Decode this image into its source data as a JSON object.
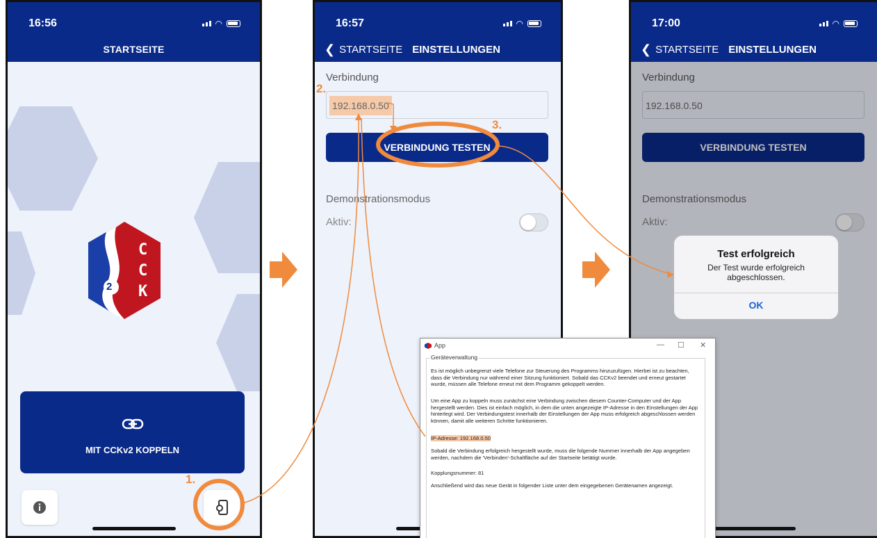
{
  "phone1": {
    "time": "16:56",
    "title": "STARTSEITE",
    "logo_letters": [
      "C",
      "C",
      "K"
    ],
    "logo_number": "2",
    "couple_button_label": "MIT CCKv2 KOPPELN"
  },
  "phone2": {
    "time": "16:57",
    "nav_back": "STARTSEITE",
    "nav_title": "EINSTELLUNGEN",
    "connection_label": "Verbindung",
    "ip_value": "192.168.0.50",
    "test_button_label": "VERBINDUNG TESTEN",
    "demo_label": "Demonstrationsmodus",
    "active_label": "Aktiv:"
  },
  "phone3": {
    "time": "17:00",
    "nav_back": "STARTSEITE",
    "nav_title": "EINSTELLUNGEN",
    "connection_label": "Verbindung",
    "ip_value": "192.168.0.50",
    "test_button_label": "VERBINDUNG TESTEN",
    "demo_label": "Demonstrationsmodus",
    "active_label": "Aktiv:",
    "alert": {
      "title": "Test erfolgreich",
      "message": "Der Test wurde erfolgreich abgeschlossen.",
      "ok_label": "OK"
    }
  },
  "steps": {
    "one": "1.",
    "two": "2.",
    "three": "3."
  },
  "desktop_window": {
    "title": "App",
    "controls": {
      "minimize": "—",
      "maximize": "☐",
      "close": "✕"
    },
    "group_title": "Geräteverwaltung",
    "para1": "Es ist möglich unbegrenzt viele Telefone zur Steuerung des Programms hinzuzufügen. Hierbei ist zu beachten, dass die Verbindung nur während einer Sitzung funktioniert. Sobald das CCKv2 beendet und erneut gestartet wurde, müssen alle Telefone erneut mit dem Programm gekoppelt werden.",
    "para2": "Um eine App zu koppeln muss zunächst eine Verbindung zwischen diesem Counter-Computer und der App hergestellt werden. Dies ist einfach möglich, in dem die unten angezeigte IP-Adresse in den Einstellungen der App hinterlegt wird. Der Verbindungstest innerhalb der Einstellungen der App muss erfolgreich abgeschlossen werden können, damit alle weiteren Schritte funktionieren.",
    "ip_line": "IP-Adresse: 192.168.0.50",
    "para3": "Sobald die Verbindung erfolgreich hergestellt wurde, muss die folgende Nummer innerhalb der App angegeben werden, nachdem die 'Verbinden'-Schaltfläche auf der Startseite betätigt wurde.",
    "pairing_line": "Kopplungsnummer: 81",
    "para4": "Anschließend wird das neue Gerät in folgender Liste unter dem eingegebenen Gerätenamen angezeigt."
  },
  "colors": {
    "header": "#0a2a8a",
    "annotation": "#f08a3c",
    "logo_red": "#c0161f"
  }
}
